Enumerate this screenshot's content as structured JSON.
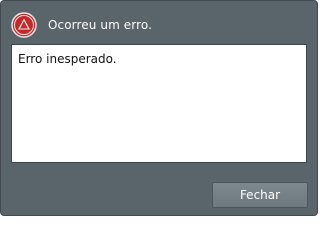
{
  "dialog": {
    "title": "Ocorreu um erro.",
    "message": "Erro inesperado.",
    "close_label": "Fechar",
    "icon": "warning-icon",
    "colors": {
      "background": "#5a646b",
      "icon_ring": "#e8e8e8",
      "icon_fill": "#c62828"
    }
  }
}
